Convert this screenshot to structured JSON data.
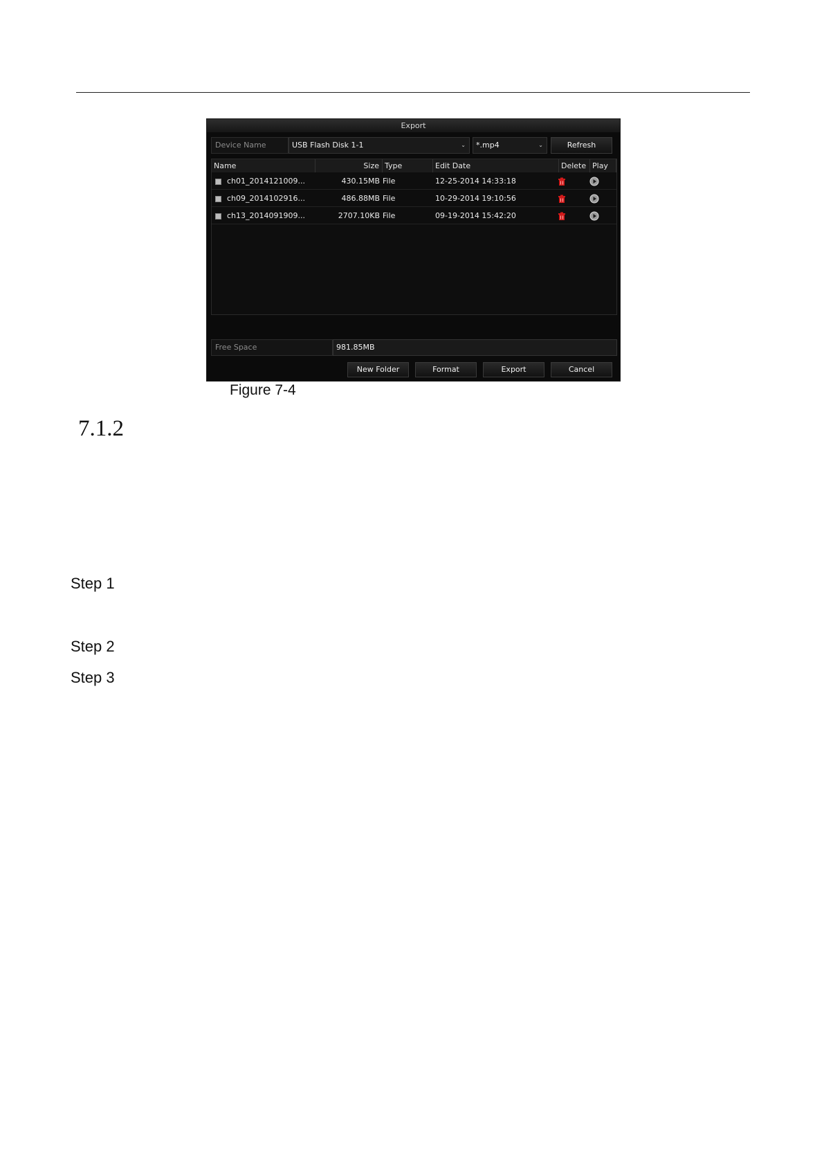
{
  "dialog": {
    "title": "Export",
    "device_name_label": "Device Name",
    "device_name_value": "USB Flash Disk 1-1",
    "file_type_value": "*.mp4",
    "refresh_label": "Refresh",
    "columns": {
      "name": "Name",
      "size": "Size",
      "type": "Type",
      "edit_date": "Edit Date",
      "delete": "Delete",
      "play": "Play"
    },
    "files": [
      {
        "name": "ch01_2014121009...",
        "size": "430.15MB",
        "type": "File",
        "edit_date": "12-25-2014 14:33:18"
      },
      {
        "name": "ch09_2014102916...",
        "size": "486.88MB",
        "type": "File",
        "edit_date": "10-29-2014 19:10:56"
      },
      {
        "name": "ch13_2014091909...",
        "size": "2707.10KB",
        "type": "File",
        "edit_date": "09-19-2014 15:42:20"
      }
    ],
    "free_space_label": "Free Space",
    "free_space_value": "981.85MB",
    "buttons": {
      "new_folder": "New Folder",
      "format": "Format",
      "export": "Export",
      "cancel": "Cancel"
    },
    "colors": {
      "background": "#0b0b0b",
      "delete_icon": "#d11a1a",
      "play_icon": "#bdbdbd"
    },
    "icons": {
      "delete": "trash-icon",
      "play": "play-icon",
      "dropdown": "chevron-down-icon"
    }
  },
  "document": {
    "caption": "Figure 7-4",
    "section_number": "7.1.2",
    "steps": [
      "Step 1",
      "Step 2",
      "Step 3"
    ]
  }
}
